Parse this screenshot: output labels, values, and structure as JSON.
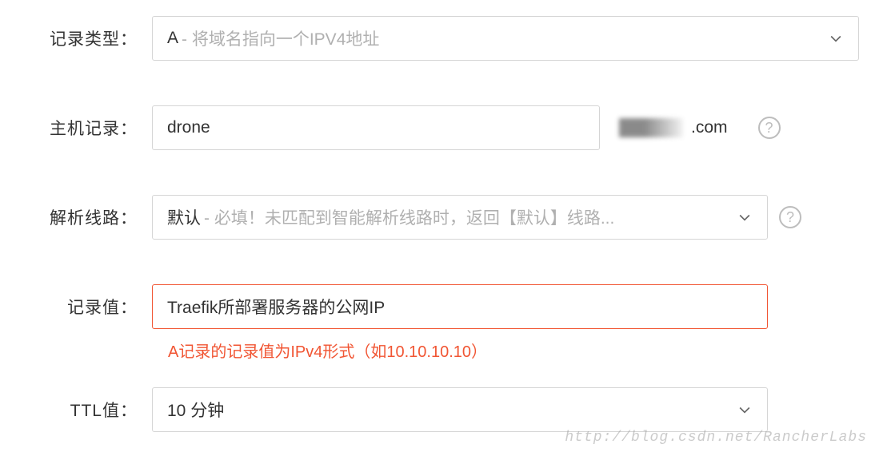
{
  "labels": {
    "record_type": "记录类型",
    "host_record": "主机记录",
    "resolve_line": "解析线路",
    "record_value": "记录值",
    "ttl": "TTL值"
  },
  "record_type": {
    "value": "A",
    "hint": "- 将域名指向一个IPV4地址"
  },
  "host_record": {
    "value": "drone",
    "domain_suffix": ".com"
  },
  "resolve_line": {
    "value": "默认",
    "hint": "- 必填！未匹配到智能解析线路时，返回【默认】线路..."
  },
  "record_value": {
    "value": "Traefik所部署服务器的公网IP",
    "error_message": "A记录的记录值为IPv4形式（如10.10.10.10）"
  },
  "ttl": {
    "value": "10 分钟"
  },
  "help_icon_text": "?",
  "watermark": "http://blog.csdn.net/RancherLabs"
}
